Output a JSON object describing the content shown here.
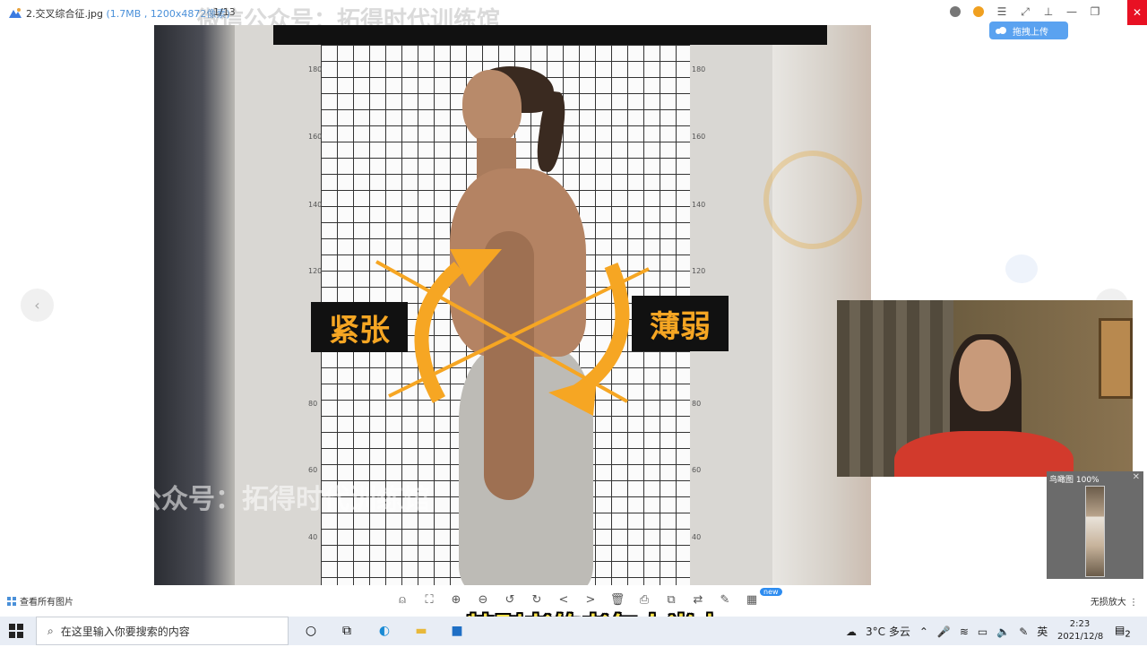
{
  "window": {
    "file_name": "2.交叉综合征.jpg",
    "file_meta": "(1.7MB , 1200x4872像素)",
    "page_count": "1/13",
    "upload_label": "拖拽上传",
    "watermark": "微信公众号：拓得时代训练馆"
  },
  "photo": {
    "label_tense": "紧张",
    "label_weak": "薄弱",
    "watermark": "微信公众号：拓得时代训练馆",
    "scale_ticks": [
      "180",
      "160",
      "140",
      "120",
      "80",
      "60",
      "40"
    ]
  },
  "navigator": {
    "title": "鸟瞰图 100%"
  },
  "bottombar": {
    "view_all_label": "查看所有图片",
    "new_badge": "new",
    "lossless_label": "无损放大 ⋮"
  },
  "subtitle": "特别老的老年人当中",
  "taskbar": {
    "search_placeholder": "在这里输入你要搜索的内容",
    "weather": "3°C 多云",
    "ime": "英",
    "time": "2:23",
    "date": "2021/12/8",
    "notification_count": "2"
  },
  "colors": {
    "accent_orange": "#f6a623",
    "close_red": "#e81123",
    "upload_blue": "#5aa2f0",
    "subtitle_yellow": "#f7e24a"
  }
}
